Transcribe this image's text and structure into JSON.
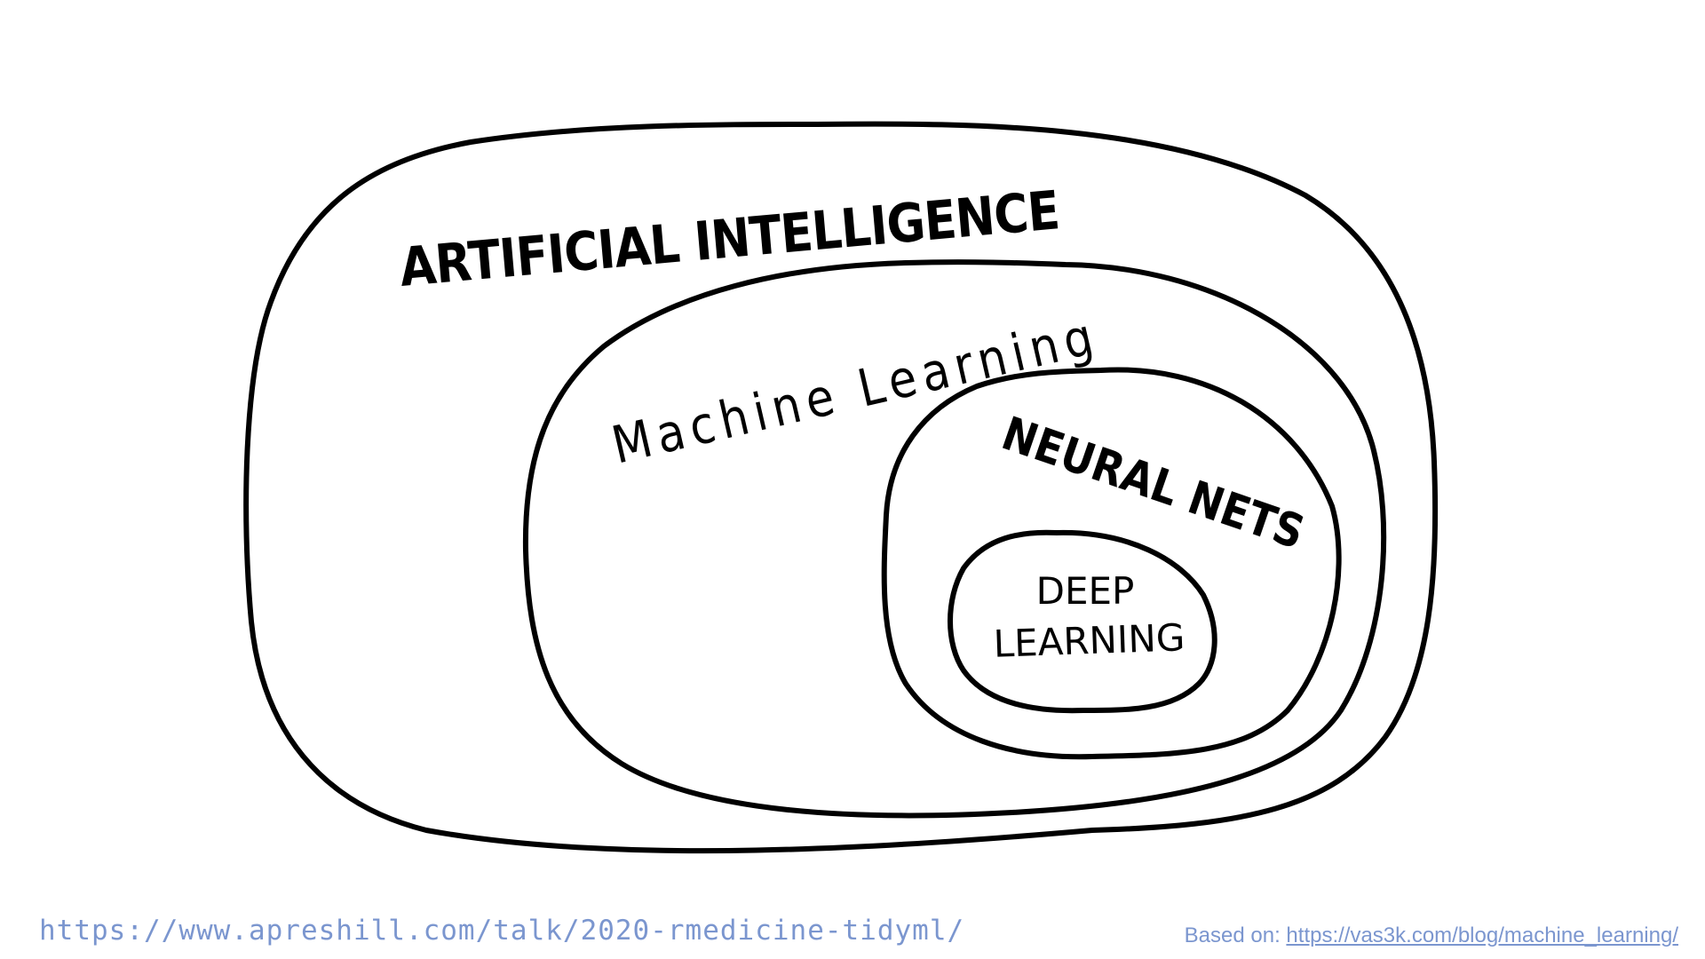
{
  "diagram": {
    "regions": [
      {
        "id": "ai",
        "label": "ARTIFICIAL INTELLIGENCE"
      },
      {
        "id": "ml",
        "label": "Machine Learning"
      },
      {
        "id": "nn",
        "label": "NEURAL NETS"
      },
      {
        "id": "dl",
        "label_lines": [
          "DEEP",
          "LEARNING"
        ]
      }
    ],
    "relation": "nested subsets: DEEP LEARNING within NEURAL NETS within Machine Learning within ARTIFICIAL INTELLIGENCE"
  },
  "footer": {
    "talk_url": "https://www.apreshill.com/talk/2020-rmedicine-tidyml/",
    "credit_prefix": "Based on: ",
    "credit_link": "https://vas3k.com/blog/machine_learning/"
  },
  "colors": {
    "ink": "#000000",
    "footer_text": "#7b96cf",
    "background": "#ffffff"
  }
}
